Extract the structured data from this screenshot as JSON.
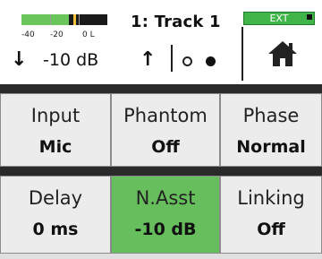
{
  "header": {
    "meter": {
      "level_fraction": 0.55,
      "peak_fraction": 0.6,
      "scale_labels": [
        "-40",
        "-20",
        "0 L"
      ]
    },
    "track_title": "1: Track 1",
    "ext_label": "EXT",
    "gain": {
      "down_icon": "arrow-down-icon",
      "value": "-10 dB",
      "up_icon": "arrow-up-icon"
    },
    "home_icon": "home-icon"
  },
  "params": [
    {
      "label": "Input",
      "value": "Mic",
      "active": false
    },
    {
      "label": "Phantom",
      "value": "Off",
      "active": false
    },
    {
      "label": "Phase",
      "value": "Normal",
      "active": false
    },
    {
      "label": "Delay",
      "value": "0 ms",
      "active": false
    },
    {
      "label": "N.Asst",
      "value": "-10 dB",
      "active": true
    },
    {
      "label": "Linking",
      "value": "Off",
      "active": false
    }
  ],
  "colors": {
    "meter_green": "#6ac55a",
    "meter_peak": "#f2c23a",
    "ext_green": "#3fb54a",
    "active_cell": "#66bf5c",
    "cell_bg": "#ececec"
  }
}
